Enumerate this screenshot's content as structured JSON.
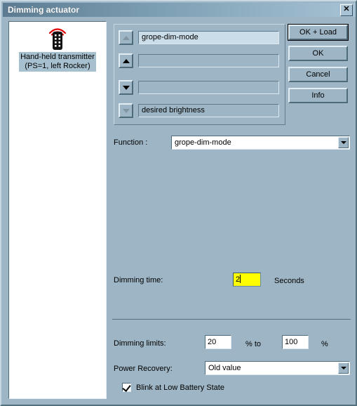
{
  "window": {
    "title": "Dimming actuator",
    "close_label": "✕",
    "bg_color": "#9db5c4",
    "titlebar_from": "#5c7b91",
    "titlebar_to": "#a6c2d4"
  },
  "device_panel": {
    "item": {
      "icon": "handheld-transmitter-icon",
      "label": "Hand-held transmitter\n(PS=1, left Rocker)"
    }
  },
  "link_group": {
    "rows": [
      {
        "arrow": "arrow-up-icon",
        "direction": "up",
        "enabled": false,
        "value": "grope-dim-mode",
        "highlighted": true
      },
      {
        "arrow": "arrow-up-icon",
        "direction": "up",
        "enabled": true,
        "value": "",
        "highlighted": false
      },
      {
        "arrow": "arrow-down-icon",
        "direction": "down",
        "enabled": true,
        "value": "",
        "highlighted": false
      },
      {
        "arrow": "arrow-down-icon",
        "direction": "down",
        "enabled": false,
        "value": "desired brightness",
        "highlighted": false
      }
    ]
  },
  "buttons": [
    {
      "label": "OK + Load",
      "is_default": true
    },
    {
      "label": "OK",
      "is_default": false
    },
    {
      "label": "Cancel",
      "is_default": false
    },
    {
      "label": "Info",
      "is_default": false
    }
  ],
  "form": {
    "function": {
      "label": "Function :",
      "value": "grope-dim-mode"
    },
    "dimming_time": {
      "label": "Dimming time:",
      "value": "2",
      "unit": "Seconds"
    },
    "dimming_limits": {
      "label": "Dimming limits:",
      "min_value": "20",
      "mid_unit": "% to",
      "max_value": "100",
      "end_unit": "%"
    },
    "power_recovery": {
      "label": "Power Recovery:",
      "value": "Old value"
    },
    "blink_low_battery": {
      "label": "Blink at Low Battery State",
      "checked": true
    }
  }
}
